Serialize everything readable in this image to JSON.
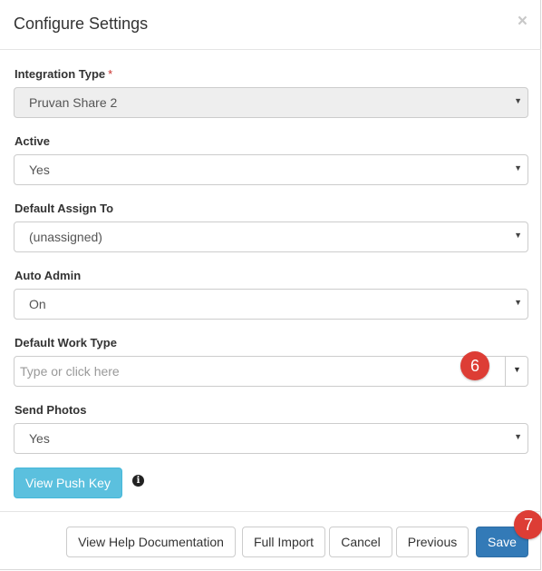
{
  "header": {
    "title": "Configure Settings",
    "close_symbol": "×"
  },
  "fields": {
    "integration_type": {
      "label": "Integration Type",
      "required_mark": "*",
      "value": "Pruvan Share 2"
    },
    "active": {
      "label": "Active",
      "value": "Yes"
    },
    "default_assign_to": {
      "label": "Default Assign To",
      "value": "(unassigned)"
    },
    "auto_admin": {
      "label": "Auto Admin",
      "value": "On"
    },
    "default_work_type": {
      "label": "Default Work Type",
      "placeholder": "Type or click here"
    },
    "send_photos": {
      "label": "Send Photos",
      "value": "Yes"
    }
  },
  "actions": {
    "view_push_key": "View Push Key",
    "info_symbol": "i"
  },
  "footer": {
    "view_help": "View Help Documentation",
    "full_import": "Full Import",
    "cancel": "Cancel",
    "previous": "Previous",
    "save": "Save"
  },
  "annotations": {
    "badge_6": "6",
    "badge_7": "7"
  },
  "icons": {
    "caret": "chevron-down-icon",
    "close": "close-icon",
    "info": "info-icon"
  },
  "colors": {
    "primary": "#337ab7",
    "info": "#5bc0de",
    "badge": "#dd3d35",
    "required": "#c9302c"
  }
}
